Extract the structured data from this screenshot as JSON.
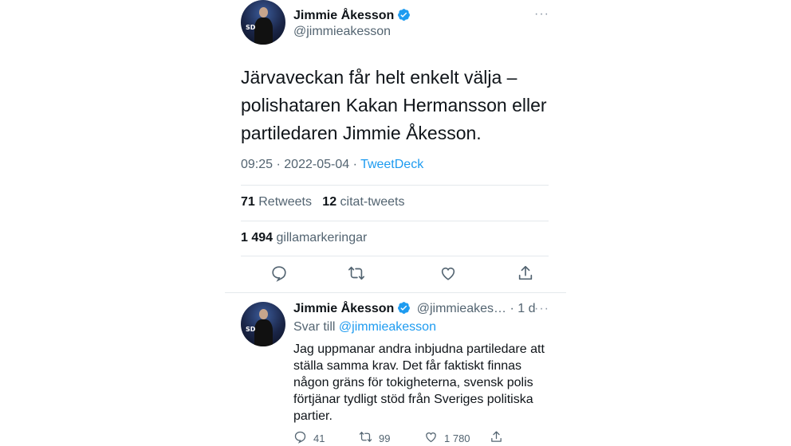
{
  "tweet": {
    "author_name": "Jimmie Åkesson",
    "author_handle": "@jimmieakesson",
    "more_label": "···",
    "text": "Järvaveckan får helt enkelt välja – polishataren Kakan Hermansson eller partiledaren Jimmie Åkesson.",
    "time": "09:25",
    "date": "2022-05-04",
    "separator": "·",
    "source": "TweetDeck",
    "retweets_count": "71",
    "retweets_label": "Retweets",
    "quotes_count": "12",
    "quotes_label": "citat-tweets",
    "likes_count": "1 494",
    "likes_label": "gillamarkeringar",
    "avatar_logo": "SD",
    "actions": [
      "reply-icon",
      "retweet-icon",
      "like-icon",
      "share-icon"
    ]
  },
  "reply": {
    "author_name": "Jimmie Åkesson",
    "author_handle": "@jimmieakes…",
    "separator": "·",
    "age": "1 d",
    "more_label": "···",
    "replying_prefix": "Svar till",
    "replying_to": "@jimmieakesson",
    "text": "Jag uppmanar andra inbjudna partiledare att ställa samma krav. Det får faktiskt finnas någon gräns för tokigheterna, svensk polis förtjänar tydligt stöd från Sveriges politiska partier.",
    "reply_count": "41",
    "retweet_count": "99",
    "like_count": "1 780",
    "avatar_logo": "SD"
  },
  "colors": {
    "accent": "#1d9bf0",
    "text": "#0f1419",
    "muted": "#536471",
    "divider": "#e4e9ec"
  }
}
